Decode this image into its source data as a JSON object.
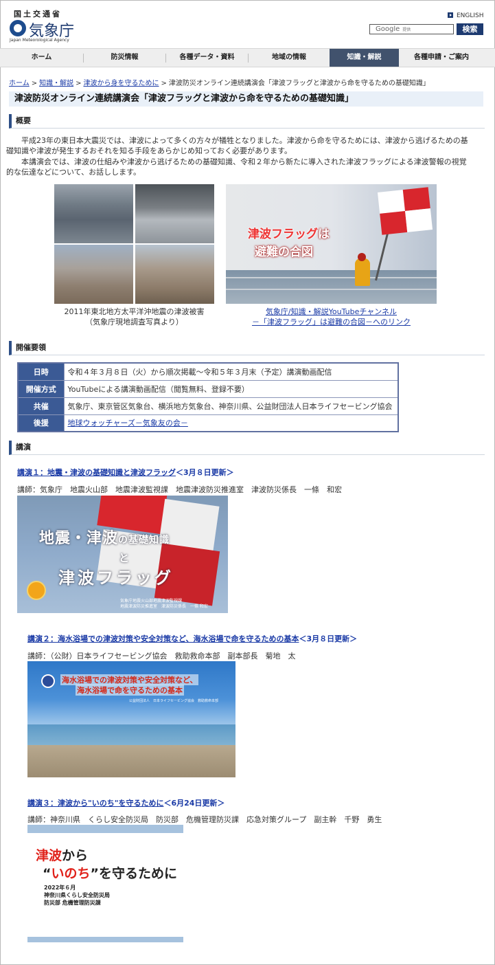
{
  "header": {
    "ministry": "国土交通省",
    "agency": "気象庁",
    "agency_en": "Japan Meteorological Agency",
    "english_link": "ENGLISH",
    "search_google": "Google",
    "search_placeholder": "提供",
    "search_button": "検索"
  },
  "nav": {
    "items": [
      {
        "label": "ホーム"
      },
      {
        "label": "防災情報"
      },
      {
        "label": "各種データ・資料"
      },
      {
        "label": "地域の情報"
      },
      {
        "label": "知識・解説"
      },
      {
        "label": "各種申請・ご案内"
      }
    ]
  },
  "breadcrumb": {
    "items": [
      "ホーム",
      "知識・解説",
      "津波から身を守るために"
    ],
    "current": "津波防災オンライン連続講演会「津波フラッグと津波から命を守るための基礎知識」",
    "sep": ">"
  },
  "page_title": "津波防災オンライン連続講演会「津波フラッグと津波から命を守るための基礎知識」",
  "overview": {
    "heading": "概要",
    "para1_line1": "平成23年の東日本大震災では、津波によって多くの方々が犠牲となりました。津波から命を守るためには、津波から逃げるための基",
    "para1_line2": "礎知識や津波が発生するおそれを知る手段をあらかじめ知っておく必要があります。",
    "para2_line1": "本講演会では、津波の仕組みや津波から逃げるための基礎知識、令和２年から新たに導入された津波フラッグによる津波警報の視覚",
    "para2_line2": "的な伝達などについて、お話しします。",
    "photo_caption_1": "2011年東北地方太平洋沖地震の津波被害",
    "photo_caption_2": "（気象庁現地調査写真より）",
    "flag_image_text_1": "津波フラッグ",
    "flag_image_text_2": "は",
    "flag_image_text_3": "避難の合図",
    "link_line_1": "気象庁/知識・解説YouTubeチャンネル",
    "link_line_2": "－「津波フラッグ」は避難の合図－へのリンク"
  },
  "event": {
    "heading": "開催要領",
    "rows": [
      {
        "label": "日時",
        "value": "令和４年３月８日（火）から順次掲載～令和５年３月末（予定）講演動画配信"
      },
      {
        "label": "開催方式",
        "value": "YouTubeによる講演動画配信（閲覧無料、登録不要）"
      },
      {
        "label": "共催",
        "value": "気象庁、東京管区気象台、横浜地方気象台、神奈川県、公益財団法人日本ライフセービング協会"
      },
      {
        "label": "後援",
        "value": "地球ウォッチャーズ－気象友の会－"
      }
    ]
  },
  "lectures": {
    "heading": "講演",
    "items": [
      {
        "title": "講演１：地震・津波の基礎知識と津波フラッグ",
        "update": "＜3月８日更新＞",
        "lecturer": "講師：気象庁　地震火山部　地震津波監視課　地震津波防災推進室　津波防災係長　一條　和宏",
        "img_t1": "地震・津波",
        "img_t1b": "の基礎知識",
        "img_t2": "と",
        "img_t3": "津波フラッグ",
        "img_small_1": "気象庁地震火山部地震津波監視課",
        "img_small_2": "地震津波防災推進室　津波防災係長　一條 和宏"
      },
      {
        "title": "講演２：海水浴場での津波対策や安全対策など、海水浴場で命を守るための基本",
        "update": "＜3月８日更新＞",
        "lecturer": "講師：（公財）日本ライフセービング協会　救助救命本部　副本部長　菊地　太",
        "img_t1": "海水浴場での津波対策や安全対策など、",
        "img_t2": "海水浴場で命を守るための基本",
        "img_t3": "公益財団法人　日本ライフセービング協会　救助救命本部"
      },
      {
        "title": "講演３：津波から\"いのち\"を守るために",
        "update": "＜6月24日更新＞",
        "lecturer": "講師：神奈川県　くらし安全防災局　防災部　危機管理防災課　応急対策グループ　副主幹　千野　勇生",
        "img_t1a": "津波",
        "img_t1b": "から",
        "img_t2a": "“",
        "img_t2b": "いのち",
        "img_t2c": "”を守るために",
        "img_t3_1": "2022年６月",
        "img_t3_2": "神奈川県くらし安全防災局",
        "img_t3_3": "防災部 危機管理防災課"
      }
    ]
  },
  "colors": {
    "brand_navy": "#1d3a70",
    "nav_active": "#41526d",
    "table_header": "#3b5a95",
    "link": "#1a3aa6",
    "flag_red": "#d8262d"
  }
}
